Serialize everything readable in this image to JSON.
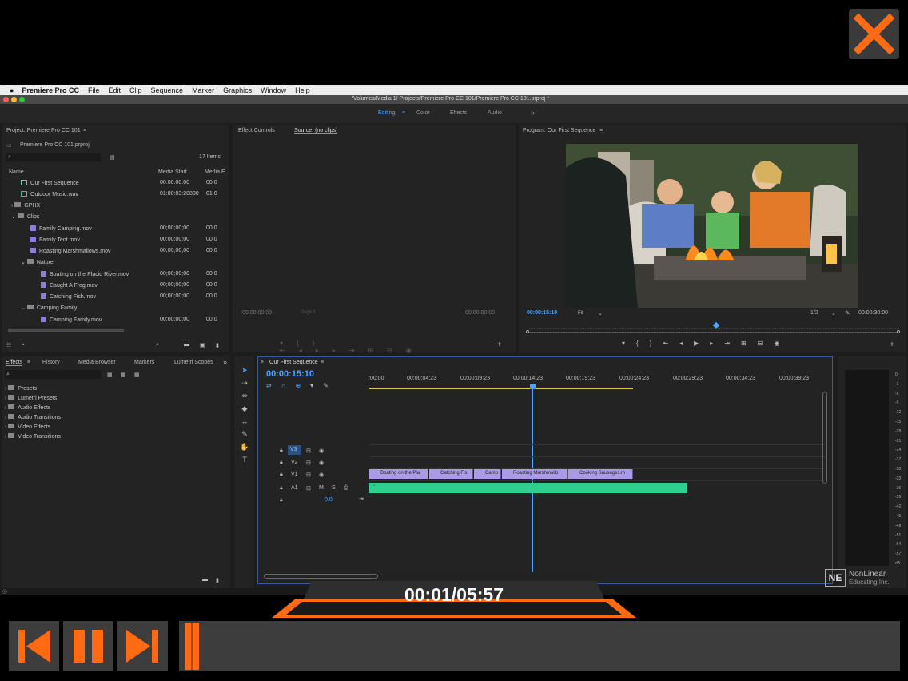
{
  "menubar": {
    "apple": "",
    "app": "Premiere Pro CC",
    "items": [
      "File",
      "Edit",
      "Clip",
      "Sequence",
      "Marker",
      "Graphics",
      "Window",
      "Help"
    ]
  },
  "titlebar": {
    "path": "/Volumes/Media 1/          Projects/Premiere Pro CC 101/Premiere Pro CC 101.prproj *"
  },
  "workspace": {
    "tabs": [
      "Editing",
      "Color",
      "Effects",
      "Audio"
    ],
    "more": "»"
  },
  "project": {
    "title": "Project: Premiere Pro CC 101",
    "file": "Premiere Pro CC 101.prproj",
    "count": "17 Items",
    "col_name": "Name",
    "col_start": "Media Start",
    "col_end": "Media E",
    "rows": [
      {
        "name": "Our First Sequence",
        "start": "00:00:00:00",
        "end": "00:0"
      },
      {
        "name": "Outdoor Music.wav",
        "start": "01:00:03:28800",
        "end": "01:0"
      },
      {
        "name": "GPHX",
        "start": "",
        "end": ""
      },
      {
        "name": "Clips",
        "start": "",
        "end": ""
      },
      {
        "name": "Family Camping.mov",
        "start": "00;00;00;00",
        "end": "00:0"
      },
      {
        "name": "Family Tent.mov",
        "start": "00;00;00;00",
        "end": "00:0"
      },
      {
        "name": "Roasting Marshmallows.mov",
        "start": "00;00;00;00",
        "end": "00:0"
      },
      {
        "name": "Nature",
        "start": "",
        "end": ""
      },
      {
        "name": "Boating on the Placid River.mov",
        "start": "00;00;00;00",
        "end": "00:0"
      },
      {
        "name": "Caught A Frog.mov",
        "start": "00;00;00;00",
        "end": "00:0"
      },
      {
        "name": "Catching Fish.mov",
        "start": "00;00;00;00",
        "end": "00:0"
      },
      {
        "name": "Camping Family",
        "start": "",
        "end": ""
      },
      {
        "name": "Camping Family.mov",
        "start": "00;00;00;00",
        "end": "00:0"
      }
    ]
  },
  "source": {
    "tab1": "Effect Controls",
    "tab2": "Source: (no clips)",
    "tc_left": "00;00;00;00",
    "tc_right": "00;00;00;00",
    "page": "Page 1"
  },
  "program": {
    "title": "Program: Our First Sequence",
    "tc": "00:00:15:10",
    "fit": "Fit",
    "ratio": "1/2",
    "duration": "00:00:30:00"
  },
  "effects": {
    "tabs": [
      "Effects",
      "History",
      "Media Browser",
      "Markers",
      "Lumetri Scopes"
    ],
    "items": [
      "Presets",
      "Lumetri Presets",
      "Audio Effects",
      "Audio Transitions",
      "Video Effects",
      "Video Transitions"
    ]
  },
  "timeline": {
    "title": "Our First Sequence",
    "tc": "00:00:15:10",
    "ruler": [
      ":00:00",
      "00:00:04:23",
      "00:00:09:23",
      "00:00:14:23",
      "00:00:19:23",
      "00:00:24:23",
      "00:00:29:23",
      "00:00:34:23",
      "00:00:39:23"
    ],
    "tracks": [
      "V3",
      "V2",
      "V1",
      "A1"
    ],
    "audio_level": "0.0",
    "clips": [
      "Boating on the Pla",
      "Catching Fis",
      "Camp",
      "Roasting Marshmallo",
      "Cooking Sausages.m"
    ]
  },
  "meter": {
    "labels": [
      "0",
      "-3",
      "-6",
      "-9",
      "-12",
      "-15",
      "-18",
      "-21",
      "-24",
      "-27",
      "-30",
      "-33",
      "-36",
      "-39",
      "-42",
      "-45",
      "-48",
      "-51",
      "-54",
      "-57",
      "dB"
    ]
  },
  "watermark": {
    "line1": "NonLinear",
    "line2": "Educating Inc.",
    "logo": "NE"
  },
  "player": {
    "time": "00:01/05:57",
    "progress": 0.003
  },
  "colors": {
    "accent": "#ff6a13",
    "timecode": "#4aa3ff",
    "clip": "#a99be8",
    "audio": "#2fcf8f"
  }
}
